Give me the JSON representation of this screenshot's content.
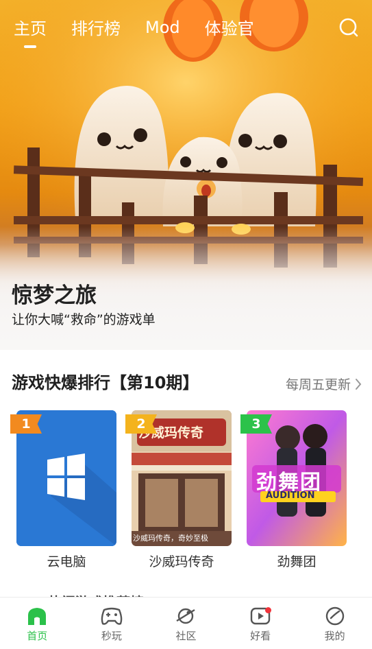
{
  "top_nav": {
    "tabs": [
      {
        "label": "主页",
        "active": true
      },
      {
        "label": "排行榜",
        "active": false
      },
      {
        "label": "Mod",
        "active": false
      },
      {
        "label": "体验官",
        "active": false
      }
    ],
    "search_icon": "search-icon"
  },
  "hero": {
    "title": "惊梦之旅",
    "subtitle": "让你大喊“救命”的游戏单"
  },
  "ranking": {
    "title": "游戏快爆排行【第10期】",
    "more": "每周五更新",
    "items": [
      {
        "rank": "1",
        "name": "云电脑",
        "badge_color": "#f28a1f"
      },
      {
        "rank": "2",
        "name": "沙威玛传奇",
        "badge_color": "#f4b31d",
        "cover_text": "沙威玛传奇",
        "cover_caption": "沙威玛传奇，奇妙至极"
      },
      {
        "rank": "3",
        "name": "劲舞团",
        "badge_color": "#2cc24a",
        "cover_text": "劲舞团",
        "cover_caption": "AUDITION"
      }
    ],
    "partial_label": "品"
  },
  "next_section_peek": "热门游戏推荐榜",
  "bottom_nav": {
    "items": [
      {
        "label": "首页",
        "icon": "home-icon",
        "active": true
      },
      {
        "label": "秒玩",
        "icon": "gamepad-icon",
        "active": false
      },
      {
        "label": "社区",
        "icon": "planet-icon",
        "active": false
      },
      {
        "label": "好看",
        "icon": "play-icon",
        "active": false,
        "has_dot": true
      },
      {
        "label": "我的",
        "icon": "profile-icon",
        "active": false
      }
    ]
  },
  "colors": {
    "accent_green": "#2bc14a",
    "notification_red": "#f0333a"
  }
}
